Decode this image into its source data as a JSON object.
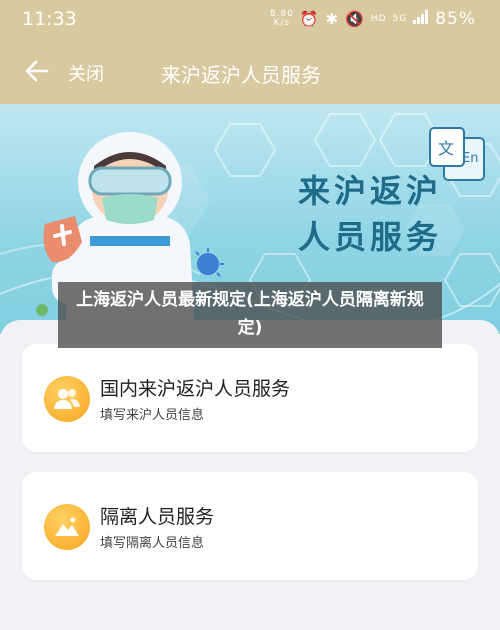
{
  "status_bar": {
    "time": "11:33",
    "speed_value": "8.80",
    "speed_unit": "K/s",
    "network_label": "HD",
    "signal_label": "5G",
    "battery": "85%"
  },
  "app_bar": {
    "close_label": "关闭",
    "title": "来沪返沪人员服务"
  },
  "banner": {
    "heading_line1": "来沪返",
    "heading_line2": "沪",
    "heading_full": "来沪返沪人员服务",
    "translate_zh": "文",
    "translate_en": "En"
  },
  "caption": {
    "text": "上海返沪人员最新规定(上海返沪人员隔离新规定)"
  },
  "services": [
    {
      "title": "国内来沪返沪人员服务",
      "subtitle": "填写来沪人员信息",
      "icon": "people-icon"
    },
    {
      "title": "隔离人员服务",
      "subtitle": "填写隔离人员信息",
      "icon": "mountain-icon"
    }
  ],
  "colors": {
    "header_bg": "#d9c9a0",
    "banner_text": "#1f6b8a",
    "icon_orange": "#f7a51c"
  }
}
